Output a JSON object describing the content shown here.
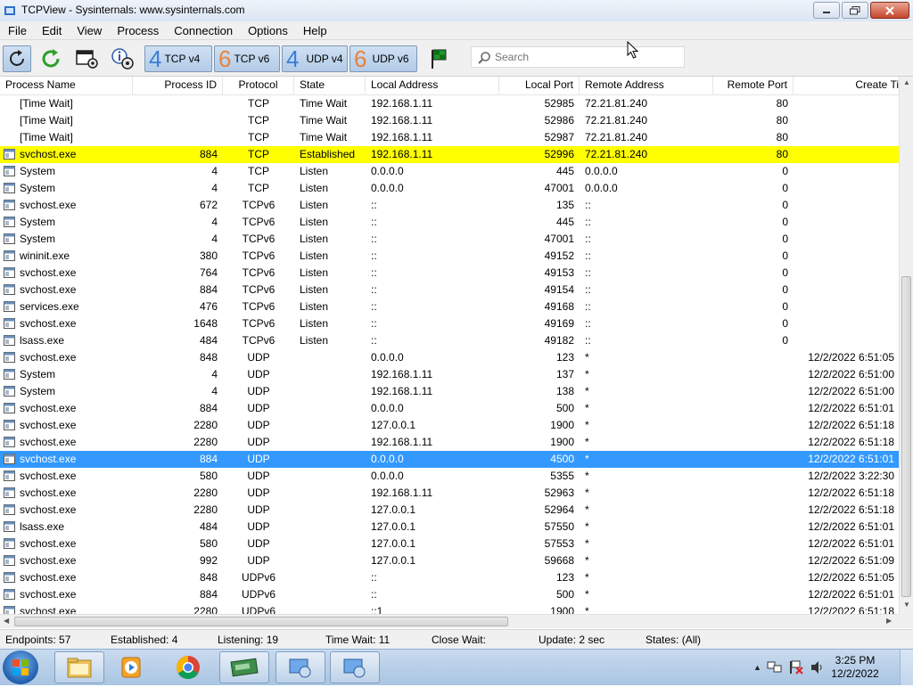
{
  "window": {
    "title": "TCPView - Sysinternals: www.sysinternals.com"
  },
  "menu": [
    "File",
    "Edit",
    "View",
    "Process",
    "Connection",
    "Options",
    "Help"
  ],
  "toolbar": {
    "filters": [
      {
        "num": "4",
        "label": "TCP v4"
      },
      {
        "num": "6",
        "label": "TCP v6"
      },
      {
        "num": "4",
        "label": "UDP v4"
      },
      {
        "num": "6",
        "label": "UDP v6"
      }
    ],
    "search_placeholder": "Search"
  },
  "columns": [
    "Process Name",
    "Process ID",
    "Protocol",
    "State",
    "Local Address",
    "Local Port",
    "Remote Address",
    "Remote Port",
    "Create Ti"
  ],
  "rows": [
    {
      "name": "[Time Wait]",
      "pid": "",
      "proto": "TCP",
      "state": "Time Wait",
      "laddr": "192.168.1.11",
      "lport": "52985",
      "raddr": "72.21.81.240",
      "rport": "80",
      "time": "",
      "icon": false,
      "hl": ""
    },
    {
      "name": "[Time Wait]",
      "pid": "",
      "proto": "TCP",
      "state": "Time Wait",
      "laddr": "192.168.1.11",
      "lport": "52986",
      "raddr": "72.21.81.240",
      "rport": "80",
      "time": "",
      "icon": false,
      "hl": ""
    },
    {
      "name": "[Time Wait]",
      "pid": "",
      "proto": "TCP",
      "state": "Time Wait",
      "laddr": "192.168.1.11",
      "lport": "52987",
      "raddr": "72.21.81.240",
      "rport": "80",
      "time": "",
      "icon": false,
      "hl": ""
    },
    {
      "name": "svchost.exe",
      "pid": "884",
      "proto": "TCP",
      "state": "Established",
      "laddr": "192.168.1.11",
      "lport": "52996",
      "raddr": "72.21.81.240",
      "rport": "80",
      "time": "",
      "icon": true,
      "hl": "yellow"
    },
    {
      "name": "System",
      "pid": "4",
      "proto": "TCP",
      "state": "Listen",
      "laddr": "0.0.0.0",
      "lport": "445",
      "raddr": "0.0.0.0",
      "rport": "0",
      "time": "",
      "icon": true,
      "hl": ""
    },
    {
      "name": "System",
      "pid": "4",
      "proto": "TCP",
      "state": "Listen",
      "laddr": "0.0.0.0",
      "lport": "47001",
      "raddr": "0.0.0.0",
      "rport": "0",
      "time": "",
      "icon": true,
      "hl": ""
    },
    {
      "name": "svchost.exe",
      "pid": "672",
      "proto": "TCPv6",
      "state": "Listen",
      "laddr": "::",
      "lport": "135",
      "raddr": "::",
      "rport": "0",
      "time": "",
      "icon": true,
      "hl": ""
    },
    {
      "name": "System",
      "pid": "4",
      "proto": "TCPv6",
      "state": "Listen",
      "laddr": "::",
      "lport": "445",
      "raddr": "::",
      "rport": "0",
      "time": "",
      "icon": true,
      "hl": ""
    },
    {
      "name": "System",
      "pid": "4",
      "proto": "TCPv6",
      "state": "Listen",
      "laddr": "::",
      "lport": "47001",
      "raddr": "::",
      "rport": "0",
      "time": "",
      "icon": true,
      "hl": ""
    },
    {
      "name": "wininit.exe",
      "pid": "380",
      "proto": "TCPv6",
      "state": "Listen",
      "laddr": "::",
      "lport": "49152",
      "raddr": "::",
      "rport": "0",
      "time": "",
      "icon": true,
      "hl": ""
    },
    {
      "name": "svchost.exe",
      "pid": "764",
      "proto": "TCPv6",
      "state": "Listen",
      "laddr": "::",
      "lport": "49153",
      "raddr": "::",
      "rport": "0",
      "time": "",
      "icon": true,
      "hl": ""
    },
    {
      "name": "svchost.exe",
      "pid": "884",
      "proto": "TCPv6",
      "state": "Listen",
      "laddr": "::",
      "lport": "49154",
      "raddr": "::",
      "rport": "0",
      "time": "",
      "icon": true,
      "hl": ""
    },
    {
      "name": "services.exe",
      "pid": "476",
      "proto": "TCPv6",
      "state": "Listen",
      "laddr": "::",
      "lport": "49168",
      "raddr": "::",
      "rport": "0",
      "time": "",
      "icon": true,
      "hl": ""
    },
    {
      "name": "svchost.exe",
      "pid": "1648",
      "proto": "TCPv6",
      "state": "Listen",
      "laddr": "::",
      "lport": "49169",
      "raddr": "::",
      "rport": "0",
      "time": "",
      "icon": true,
      "hl": ""
    },
    {
      "name": "lsass.exe",
      "pid": "484",
      "proto": "TCPv6",
      "state": "Listen",
      "laddr": "::",
      "lport": "49182",
      "raddr": "::",
      "rport": "0",
      "time": "",
      "icon": true,
      "hl": ""
    },
    {
      "name": "svchost.exe",
      "pid": "848",
      "proto": "UDP",
      "state": "",
      "laddr": "0.0.0.0",
      "lport": "123",
      "raddr": "*",
      "rport": "",
      "time": "12/2/2022 6:51:05",
      "icon": true,
      "hl": ""
    },
    {
      "name": "System",
      "pid": "4",
      "proto": "UDP",
      "state": "",
      "laddr": "192.168.1.11",
      "lport": "137",
      "raddr": "*",
      "rport": "",
      "time": "12/2/2022 6:51:00",
      "icon": true,
      "hl": ""
    },
    {
      "name": "System",
      "pid": "4",
      "proto": "UDP",
      "state": "",
      "laddr": "192.168.1.11",
      "lport": "138",
      "raddr": "*",
      "rport": "",
      "time": "12/2/2022 6:51:00",
      "icon": true,
      "hl": ""
    },
    {
      "name": "svchost.exe",
      "pid": "884",
      "proto": "UDP",
      "state": "",
      "laddr": "0.0.0.0",
      "lport": "500",
      "raddr": "*",
      "rport": "",
      "time": "12/2/2022 6:51:01",
      "icon": true,
      "hl": ""
    },
    {
      "name": "svchost.exe",
      "pid": "2280",
      "proto": "UDP",
      "state": "",
      "laddr": "127.0.0.1",
      "lport": "1900",
      "raddr": "*",
      "rport": "",
      "time": "12/2/2022 6:51:18",
      "icon": true,
      "hl": ""
    },
    {
      "name": "svchost.exe",
      "pid": "2280",
      "proto": "UDP",
      "state": "",
      "laddr": "192.168.1.11",
      "lport": "1900",
      "raddr": "*",
      "rport": "",
      "time": "12/2/2022 6:51:18",
      "icon": true,
      "hl": ""
    },
    {
      "name": "svchost.exe",
      "pid": "884",
      "proto": "UDP",
      "state": "",
      "laddr": "0.0.0.0",
      "lport": "4500",
      "raddr": "*",
      "rport": "",
      "time": "12/2/2022 6:51:01",
      "icon": true,
      "hl": "selected"
    },
    {
      "name": "svchost.exe",
      "pid": "580",
      "proto": "UDP",
      "state": "",
      "laddr": "0.0.0.0",
      "lport": "5355",
      "raddr": "*",
      "rport": "",
      "time": "12/2/2022 3:22:30",
      "icon": true,
      "hl": ""
    },
    {
      "name": "svchost.exe",
      "pid": "2280",
      "proto": "UDP",
      "state": "",
      "laddr": "192.168.1.11",
      "lport": "52963",
      "raddr": "*",
      "rport": "",
      "time": "12/2/2022 6:51:18",
      "icon": true,
      "hl": ""
    },
    {
      "name": "svchost.exe",
      "pid": "2280",
      "proto": "UDP",
      "state": "",
      "laddr": "127.0.0.1",
      "lport": "52964",
      "raddr": "*",
      "rport": "",
      "time": "12/2/2022 6:51:18",
      "icon": true,
      "hl": ""
    },
    {
      "name": "lsass.exe",
      "pid": "484",
      "proto": "UDP",
      "state": "",
      "laddr": "127.0.0.1",
      "lport": "57550",
      "raddr": "*",
      "rport": "",
      "time": "12/2/2022 6:51:01",
      "icon": true,
      "hl": ""
    },
    {
      "name": "svchost.exe",
      "pid": "580",
      "proto": "UDP",
      "state": "",
      "laddr": "127.0.0.1",
      "lport": "57553",
      "raddr": "*",
      "rport": "",
      "time": "12/2/2022 6:51:01",
      "icon": true,
      "hl": ""
    },
    {
      "name": "svchost.exe",
      "pid": "992",
      "proto": "UDP",
      "state": "",
      "laddr": "127.0.0.1",
      "lport": "59668",
      "raddr": "*",
      "rport": "",
      "time": "12/2/2022 6:51:09",
      "icon": true,
      "hl": ""
    },
    {
      "name": "svchost.exe",
      "pid": "848",
      "proto": "UDPv6",
      "state": "",
      "laddr": "::",
      "lport": "123",
      "raddr": "*",
      "rport": "",
      "time": "12/2/2022 6:51:05",
      "icon": true,
      "hl": ""
    },
    {
      "name": "svchost.exe",
      "pid": "884",
      "proto": "UDPv6",
      "state": "",
      "laddr": "::",
      "lport": "500",
      "raddr": "*",
      "rport": "",
      "time": "12/2/2022 6:51:01",
      "icon": true,
      "hl": ""
    },
    {
      "name": "svchost.exe",
      "pid": "2280",
      "proto": "UDPv6",
      "state": "",
      "laddr": "::1",
      "lport": "1900",
      "raddr": "*",
      "rport": "",
      "time": "12/2/2022 6:51:18",
      "icon": true,
      "hl": ""
    }
  ],
  "status": {
    "endpoints": "Endpoints: 57",
    "established": "Established: 4",
    "listening": "Listening: 19",
    "timewait": "Time Wait: 11",
    "closewait": "Close Wait:",
    "update": "Update: 2 sec",
    "states": "States: (All)"
  },
  "clock": {
    "time": "3:25 PM",
    "date": "12/2/2022"
  },
  "colors": {
    "highlight_yellow": "#ffff00",
    "selection_blue": "#3399ff",
    "v4_blue": "#3a7fd5",
    "v6_orange": "#e8833a"
  }
}
